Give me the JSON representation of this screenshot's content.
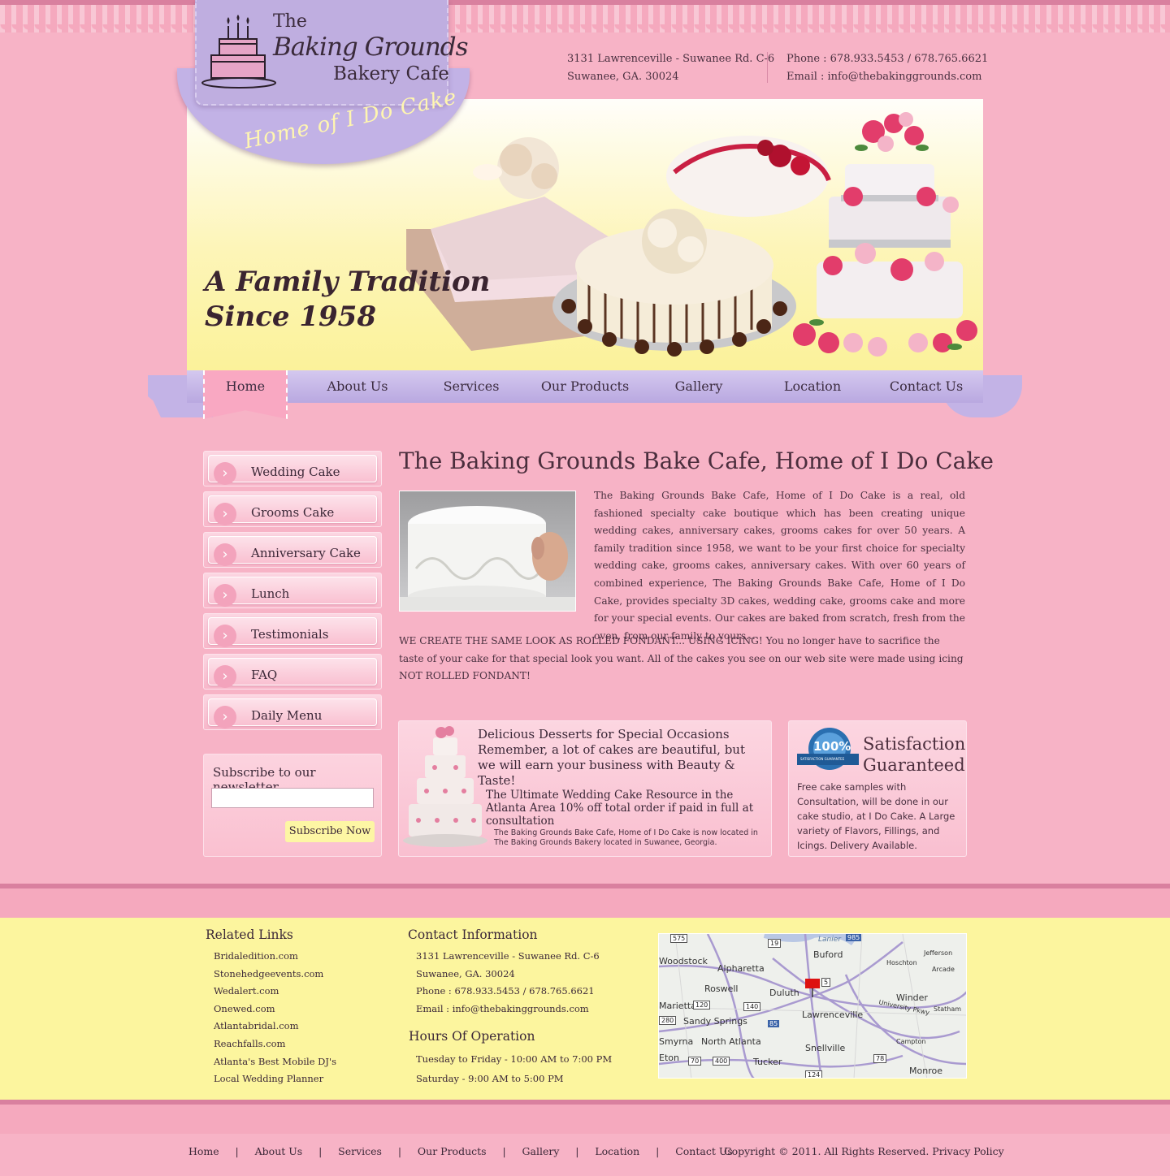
{
  "logo": {
    "the": "The",
    "baking_grounds": "Baking Grounds",
    "bakery_cafe": "Bakery Cafe",
    "tagline": "Home of I Do Cake"
  },
  "header": {
    "address_line1": "3131 Lawrenceville - Suwanee Rd. C-6",
    "address_line2": "Suwanee, GA. 30024",
    "phone": "Phone : 678.933.5453 / 678.765.6621",
    "email": "Email : info@thebakinggrounds.com"
  },
  "banner": {
    "line1": "A Family Tradition",
    "line2": "Since 1958"
  },
  "nav": {
    "items": [
      "Home",
      "About Us",
      "Services",
      "Our Products",
      "Gallery",
      "Location",
      "Contact Us"
    ],
    "active": "Home"
  },
  "sidebar": {
    "items": [
      "Wedding Cake",
      "Grooms Cake",
      "Anniversary Cake",
      "Lunch",
      "Testimonials",
      "FAQ",
      "Daily Menu"
    ]
  },
  "newsletter": {
    "title": "Subscribe to our newsletter",
    "input_value": "",
    "button": "Subscribe Now"
  },
  "main": {
    "title": "The Baking Grounds Bake Cafe, Home of I Do Cake",
    "para1": "The Baking Grounds Bake Cafe, Home of I Do Cake is a real, old fashioned specialty cake boutique which has been creating unique wedding cakes, anniversary cakes, grooms cakes for over 50 years. A family tradition since 1958, we want to be your first choice for specialty wedding cake, grooms cakes, anniversary cakes. With over 60 years of combined experience, The Baking Grounds Bake Cafe, Home of I Do Cake, provides specialty 3D cakes, wedding cake, grooms cake and more for your special events. Our cakes are baked from scratch, fresh from the oven, from our family to yours...",
    "para2": "WE CREATE THE SAME LOOK AS ROLLED FONDANT... USING ICING!  You no longer have to sacrifice the taste of your cake for that special look you want. All of the cakes you see on our web site were made using icing NOT ROLLED FONDANT!"
  },
  "promo": {
    "heading": "Delicious Desserts for Special Occasions Remember, a lot of cakes are beautiful, but we will earn your business with Beauty & Taste!",
    "middle": "The Ultimate Wedding Cake Resource in the Atlanta Area 10% off total order if paid in full at consultation",
    "small": "The Baking Grounds Bake Cafe, Home of I Do Cake is now located in The Baking Grounds Bakery located in Suwanee, Georgia."
  },
  "guarantee": {
    "badge": "100%",
    "badge_sub": "SATISFACTION GUARANTEE",
    "heading_line1": "Satisfaction",
    "heading_line2": "Guaranteed",
    "text": "Free cake samples with Consultation, will be done in our cake studio, at I Do Cake. A Large variety of Flavors, Fillings, and Icings. Delivery Available."
  },
  "footer": {
    "related_title": "Related Links",
    "related_links": [
      "Bridaledition.com",
      "Stonehedgeevents.com",
      "Wedalert.com",
      "Onewed.com",
      "Atlantabridal.com",
      "Reachfalls.com",
      "Atlanta's Best Mobile DJ's",
      "Local Wedding Planner"
    ],
    "contact_title": "Contact Information",
    "contact_lines": [
      "3131 Lawrenceville - Suwanee Rd. C-6",
      "Suwanee, GA. 30024",
      "Phone : 678.933.5453 / 678.765.6621",
      "Email : info@thebakinggrounds.com"
    ],
    "hours_title": "Hours Of Operation",
    "hours_lines": [
      "Tuesday to Friday  - 10:00 AM to 7:00 PM",
      "Saturday  - 9:00 AM to 5:00 PM"
    ],
    "map_labels": [
      "Lanier",
      "Buford",
      "Jefferson",
      "Woodstock",
      "Alpharetta",
      "Hoschton",
      "Arcade",
      "Roswell",
      "Duluth",
      "Marietta",
      "Winder",
      "Lawrenceville",
      "Sandy Springs",
      "University Pkwy",
      "Statham",
      "Smyrna",
      "North Atlanta",
      "Snellville",
      "Campton",
      "Tucker",
      "Monroe",
      "Eton"
    ],
    "map_shields": [
      "575",
      "19",
      "985",
      "5",
      "120",
      "140",
      "85",
      "280",
      "70",
      "400",
      "78",
      "124"
    ]
  },
  "bottom": {
    "links": [
      "Home",
      "About Us",
      "Services",
      "Our Products",
      "Gallery",
      "Location",
      "Contact Us"
    ],
    "copyright": "Copyright © 2011. All Rights Reserved.",
    "privacy": "Privacy Policy"
  },
  "colors": {
    "page_pink": "#f7b3c6",
    "lavender": "#c3b3e6",
    "cream_yellow": "#fcf59e",
    "dark_text": "#3c2838"
  }
}
